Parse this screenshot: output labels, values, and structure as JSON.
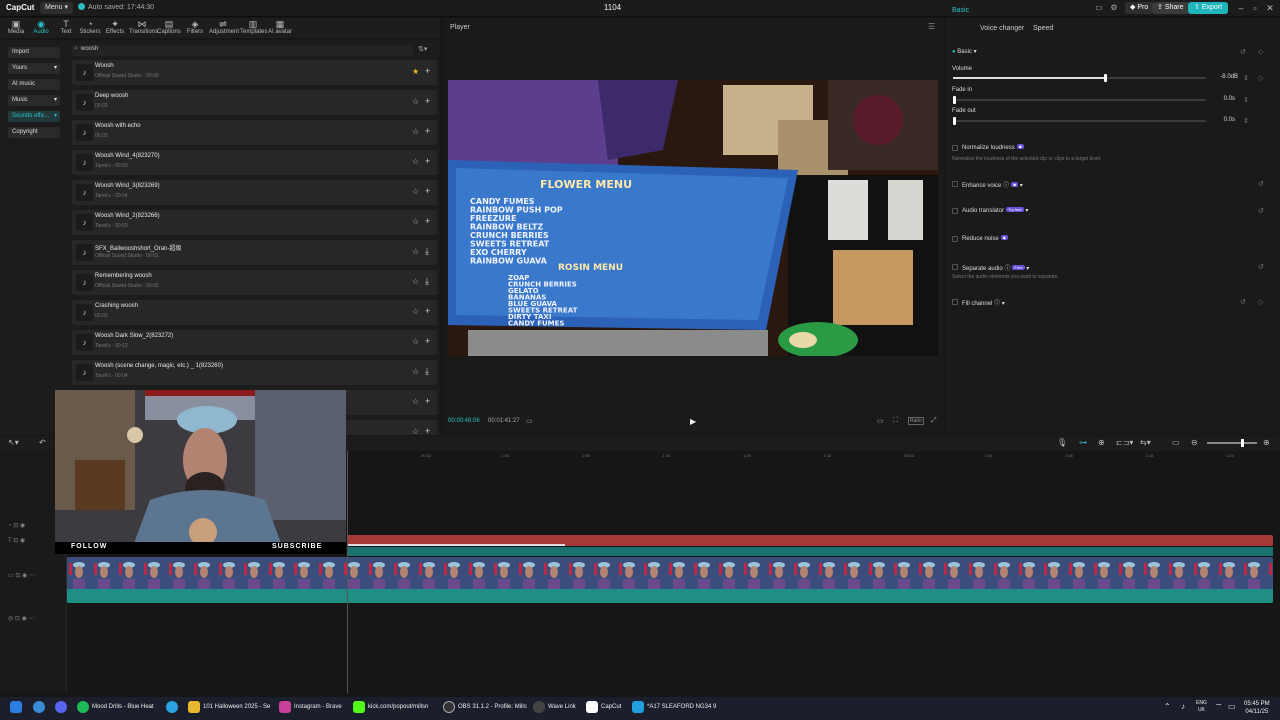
{
  "titlebar": {
    "logo": "CapCut",
    "menu": "Menu",
    "autosave": "Auto saved: 17:44:30",
    "project_name": "1104",
    "pro": "Pro",
    "share": "Share",
    "export": "Export"
  },
  "toolbar": {
    "items": [
      {
        "label": "Media",
        "icon": "media-icon"
      },
      {
        "label": "Audio",
        "icon": "audio-icon"
      },
      {
        "label": "Text",
        "icon": "text-icon"
      },
      {
        "label": "Stickers",
        "icon": "stickers-icon"
      },
      {
        "label": "Effects",
        "icon": "effects-icon"
      },
      {
        "label": "Transitions",
        "icon": "transitions-icon"
      },
      {
        "label": "Captions",
        "icon": "captions-icon"
      },
      {
        "label": "Filters",
        "icon": "filters-icon"
      },
      {
        "label": "Adjustment",
        "icon": "adjustment-icon"
      },
      {
        "label": "Templates",
        "icon": "templates-icon"
      },
      {
        "label": "AI avatar",
        "icon": "ai-avatar-icon"
      }
    ]
  },
  "sidebar": {
    "items": [
      {
        "label": "Import"
      },
      {
        "label": "Yours"
      },
      {
        "label": "AI music"
      },
      {
        "label": "Music"
      },
      {
        "label": "Sounds effe..."
      },
      {
        "label": "Copyright"
      }
    ]
  },
  "search": {
    "value": "woosh"
  },
  "sounds": [
    {
      "title": "Woosh",
      "sub": "Official Sound Studio · 00:00",
      "fav": true,
      "action": "+"
    },
    {
      "title": "Deep woosh",
      "sub": "00:03",
      "fav": false,
      "action": "+"
    },
    {
      "title": "Woosh with echo",
      "sub": "00:03",
      "fav": false,
      "action": "+"
    },
    {
      "title": "Woosh Wind_4(823270)",
      "sub": "Tarek's · 00:03",
      "fav": false,
      "action": "+"
    },
    {
      "title": "Woosh Wind_3(823269)",
      "sub": "Tarek's · 00:04",
      "fav": false,
      "action": "+"
    },
    {
      "title": "Woosh Wind_2(823266)",
      "sub": "Tarek's · 00:03",
      "fav": false,
      "action": "+"
    },
    {
      "title": "SFX_Bailwooshshort_Oran-超级",
      "sub": "Official Sound Studio · 00:01",
      "fav": false,
      "action": "⤓"
    },
    {
      "title": "Remembering woosh",
      "sub": "Official Sound Studio · 00:02",
      "fav": false,
      "action": "⤓"
    },
    {
      "title": "Crashing woosh",
      "sub": "00:01",
      "fav": false,
      "action": "+"
    },
    {
      "title": "Woosh Dark Slow_2(823272)",
      "sub": "Tarek's · 00:12",
      "fav": false,
      "action": "+"
    },
    {
      "title": "Woosh (scene change, magic, etc.) _ 1(823260)",
      "sub": "Tarek's · 00:04",
      "fav": false,
      "action": "⤓"
    },
    {
      "title": "",
      "sub": "",
      "fav": false,
      "action": "+"
    },
    {
      "title": "",
      "sub": "",
      "fav": false,
      "action": "+"
    }
  ],
  "player": {
    "header": "Player",
    "time_current": "00:00:48:06",
    "time_total": "00:01:41:27",
    "ratio_label": "Ratio"
  },
  "video_frame": {
    "sign_title": "FLOWER MENU",
    "sign_rows": [
      "CANDY FUMES",
      "RAINBOW PUSH POP",
      "FREEZURE",
      "RAINBOW BELTZ",
      "CRUNCH BERRIES",
      "SWEETS RETREAT",
      "EXO CHERRY",
      "RAINBOW GUAVA"
    ],
    "sign_subtitle": "ROSIN MENU",
    "sign_rows2": [
      "ZOAP",
      "CRUNCH BERRIES",
      "GELATO",
      "BANANAS",
      "BLUE GUAVA",
      "SWEETS RETREAT",
      "DIRTY TAXI",
      "CANDY FUMES"
    ]
  },
  "props": {
    "tabs": [
      "Basic",
      "Voice changer",
      "Speed"
    ],
    "basic": "Basic",
    "volume": {
      "label": "Volume",
      "value": "-8.0dB",
      "level": 0.6
    },
    "fade_in": {
      "label": "Fade in",
      "value": "0.0s",
      "level": 0
    },
    "fade_out": {
      "label": "Fade out",
      "value": "0.0s",
      "level": 0
    },
    "normalize": {
      "label": "Normalize loudness",
      "desc": "Normalize the loudness of the selected clip or clips to a target level."
    },
    "enhance": {
      "label": "Enhance voice"
    },
    "translator": {
      "label": "Audio translator",
      "badge": "Try free"
    },
    "reduce": {
      "label": "Reduce noise"
    },
    "separate": {
      "label": "Separate audio",
      "badge": "Free",
      "desc": "Select the audio elements you want to separate."
    },
    "fill": {
      "label": "Fill channel"
    }
  },
  "ruler": [
    "00:02",
    "1:00",
    "1:08",
    "1:16",
    "1:24",
    "1:32",
    "00:03",
    "1:00",
    "1:08",
    "1:16",
    "1:24"
  ],
  "webcam": {
    "follow": "FOLLOW",
    "subscribe": "SUBSCRIBE"
  },
  "taskbar": {
    "apps": [
      "Mood Drills - Blue Heat",
      "101 Halloween 2025 - Se",
      "Instagram - Brave",
      "kick.com/popout/millsn",
      "OBS 31.1.2 - Profile: Mills",
      "Wave Link",
      "CapCut",
      "*A17 SLEAFORD NG34 9"
    ],
    "lang": "ENG",
    "lang2": "UK",
    "time": "05:45 PM",
    "date": "04/11/25"
  }
}
